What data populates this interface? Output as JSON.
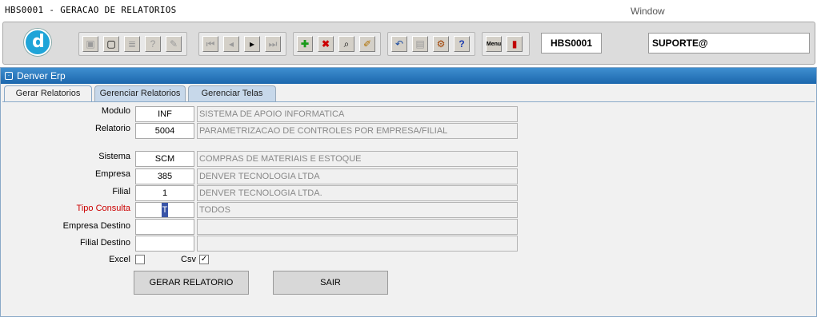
{
  "window": {
    "title": "HBS0001 - GERACAO DE RELATORIOS",
    "menu": "Window"
  },
  "toolbar": {
    "logo": "d",
    "module_code": "HBS0001",
    "user": "SUPORTE@",
    "icons": [
      "save-icon",
      "screen-icon",
      "print-icon",
      "help-query-icon",
      "edit-query-icon",
      "first-record-icon",
      "prev-record-icon",
      "next-record-icon",
      "last-record-icon",
      "insert-record-icon",
      "delete-record-icon",
      "query-icon",
      "clear-icon",
      "undo-icon",
      "paste-icon",
      "tools-icon",
      "help-icon",
      "menu-icon",
      "exit-icon"
    ],
    "menu_label": "Menu"
  },
  "app": {
    "header": "Denver Erp"
  },
  "tabs": [
    {
      "label": "Gerar Relatorios"
    },
    {
      "label": "Gerenciar Relatorios"
    },
    {
      "label": "Gerenciar Telas"
    }
  ],
  "form": {
    "modulo": {
      "label": "Modulo",
      "value": "INF",
      "desc": "SISTEMA DE APOIO INFORMATICA"
    },
    "relatorio": {
      "label": "Relatorio",
      "value": "5004",
      "desc": "PARAMETRIZACAO DE CONTROLES POR EMPRESA/FILIAL"
    },
    "sistema": {
      "label": "Sistema",
      "value": "SCM",
      "desc": "COMPRAS DE MATERIAIS E ESTOQUE"
    },
    "empresa": {
      "label": "Empresa",
      "value": "385",
      "desc": "DENVER TECNOLOGIA LTDA"
    },
    "filial": {
      "label": "Filial",
      "value": "1",
      "desc": "DENVER TECNOLOGIA LTDA."
    },
    "tipo_consulta": {
      "label": "Tipo Consulta",
      "value": "T",
      "desc": "TODOS"
    },
    "empresa_destino": {
      "label": "Empresa Destino",
      "value": "",
      "desc": ""
    },
    "filial_destino": {
      "label": "Filial Destino",
      "value": "",
      "desc": ""
    },
    "excel": {
      "label": "Excel",
      "checked": false
    },
    "csv": {
      "label": "Csv",
      "checked": true,
      "mark": "✓"
    }
  },
  "buttons": {
    "gerar": "GERAR RELATORIO",
    "sair": "SAIR"
  },
  "colors": {
    "header_blue": "#1c67ad",
    "tab_blue": "#c7d8ea",
    "required_red": "#cc0000",
    "logo_blue": "#1fa4d8"
  }
}
